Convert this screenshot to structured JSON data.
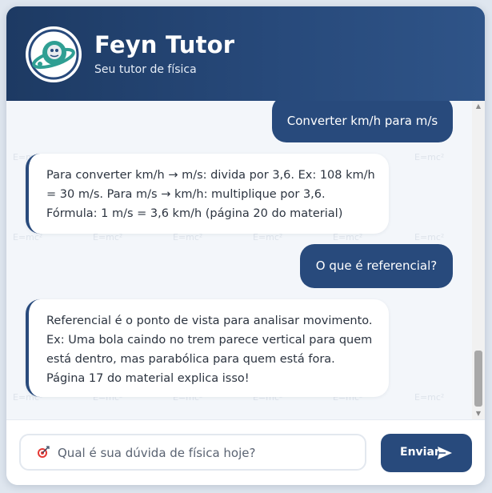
{
  "header": {
    "title": "Feyn Tutor",
    "subtitle": "Seu tutor de física",
    "avatar_icon": "astronaut-planet-icon"
  },
  "colors": {
    "header_dark": "#1d3a63",
    "accent": "#284a7c",
    "chat_background": "#f3f6fa",
    "watermark": "#dde3eb"
  },
  "chat": {
    "watermark_text": "E=mc²",
    "messages": [
      {
        "role": "user",
        "text": "Converter km/h para m/s"
      },
      {
        "role": "bot",
        "lines": [
          "Para converter km/h → m/s: divida por 3,6. Ex: 108 km/h",
          "= 30 m/s. Para m/s → km/h: multiplique por 3,6.",
          "Fórmula: 1 m/s = 3,6 km/h (página 20 do material)"
        ]
      },
      {
        "role": "user",
        "text": "O que é referencial?"
      },
      {
        "role": "bot",
        "lines": [
          "Referencial é o ponto de vista para analisar movimento.",
          "Ex: Uma bola caindo no trem parece vertical para quem",
          "está dentro, mas parabólica para quem está fora.",
          "Página 17 do material explica isso!"
        ]
      }
    ]
  },
  "composer": {
    "icon": "target-icon",
    "placeholder": "Qual é sua dúvida de física hoje?",
    "value": "",
    "send_label": "Enviar",
    "send_icon": "send-arrow-icon"
  }
}
